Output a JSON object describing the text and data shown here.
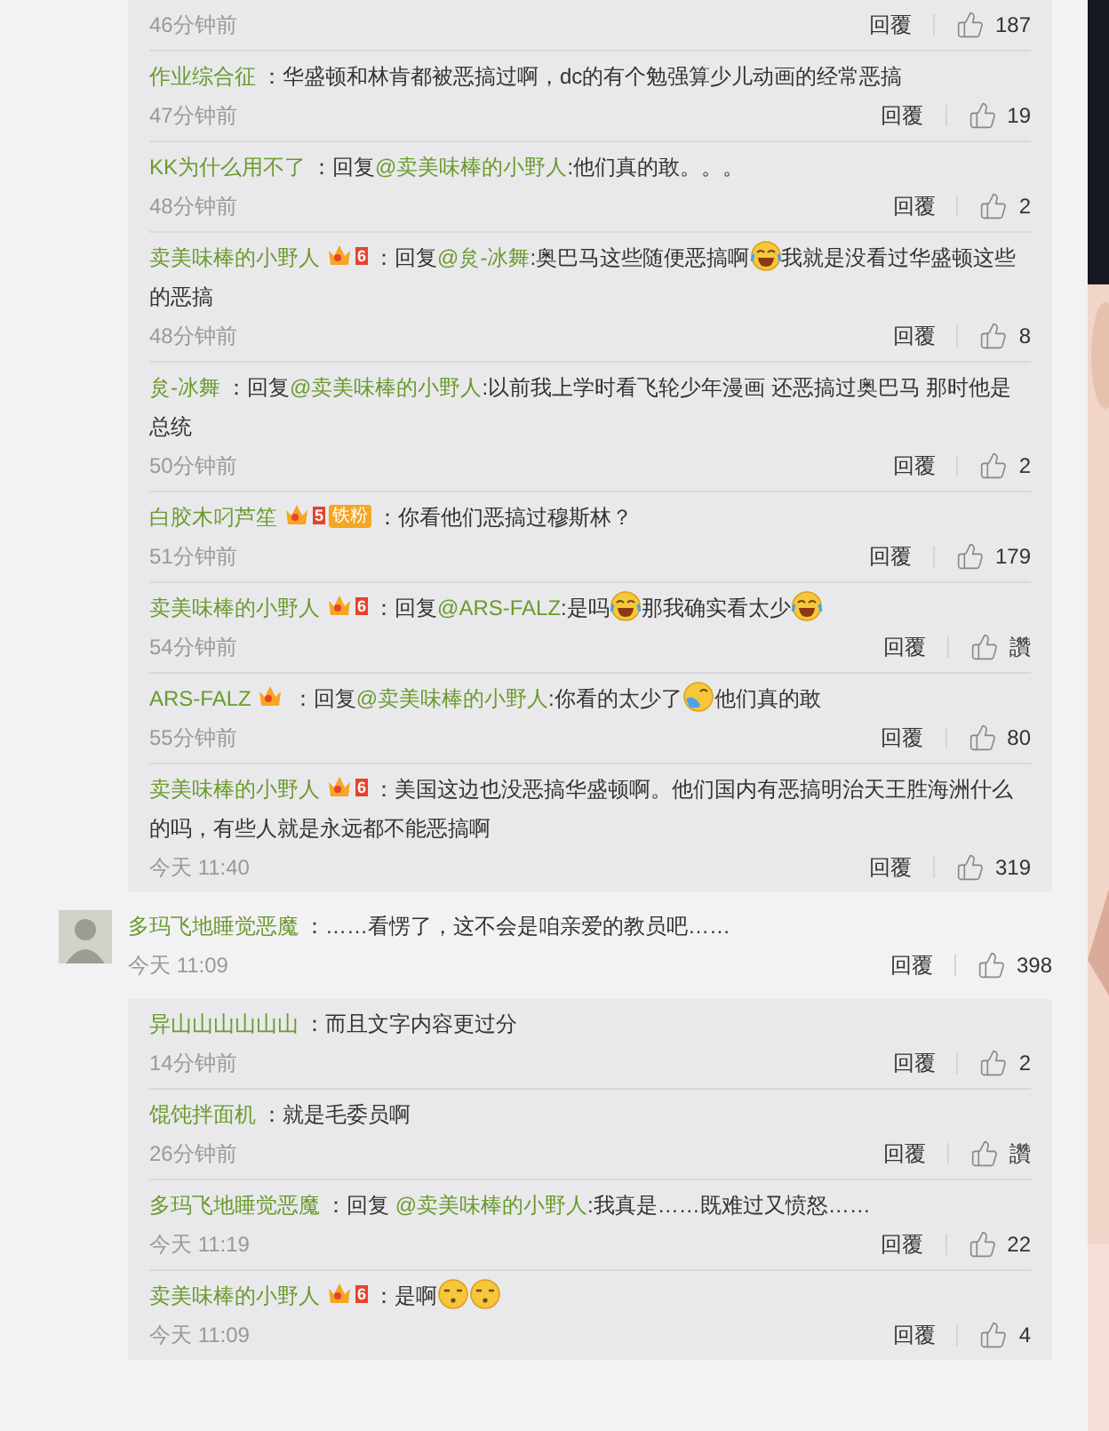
{
  "threads": [
    {
      "kind": "replies",
      "replies": [
        {
          "time": "46分钟前",
          "reply": "回覆",
          "likes": "187"
        },
        {
          "user": "作业综合征",
          "colon": "：",
          "segments": [
            {
              "kind": "text",
              "text": "华盛顿和林肯都被恶搞过啊，dc的有个勉强算少儿动画的经常恶搞"
            }
          ],
          "time": "47分钟前",
          "reply": "回覆",
          "likes": "19"
        },
        {
          "user": "KK为什么用不了",
          "colon": "：",
          "segments": [
            {
              "kind": "text",
              "text": "回复"
            },
            {
              "kind": "mention",
              "text": "@卖美味棒的小野人"
            },
            {
              "kind": "text",
              "text": ":他们真的敢。。。"
            }
          ],
          "time": "48分钟前",
          "reply": "回覆",
          "likes": "2"
        },
        {
          "user": "卖美味棒的小野人",
          "badge": {
            "kind": "level",
            "level": "6"
          },
          "colon": "：",
          "segments": [
            {
              "kind": "text",
              "text": "回复"
            },
            {
              "kind": "mention",
              "text": "@炱-冰舞"
            },
            {
              "kind": "text",
              "text": ":奥巴马这些随便恶搞啊"
            },
            {
              "kind": "laughing"
            },
            {
              "kind": "text",
              "text": "我就是没看过华盛顿这些的恶搞"
            }
          ],
          "time": "48分钟前",
          "reply": "回覆",
          "likes": "8"
        },
        {
          "user": "炱-冰舞",
          "colon": "：",
          "segments": [
            {
              "kind": "text",
              "text": "回复"
            },
            {
              "kind": "mention",
              "text": "@卖美味棒的小野人"
            },
            {
              "kind": "text",
              "text": ":以前我上学时看飞轮少年漫画 还恶搞过奥巴马 那时他是总统"
            }
          ],
          "time": "50分钟前",
          "reply": "回覆",
          "likes": "2"
        },
        {
          "user": "白胶木叼芦笙",
          "badge": {
            "kind": "fan",
            "level": "5",
            "label": "铁粉"
          },
          "colon": "：",
          "segments": [
            {
              "kind": "text",
              "text": "你看他们恶搞过穆斯林？"
            }
          ],
          "time": "51分钟前",
          "reply": "回覆",
          "likes": "179"
        },
        {
          "user": "卖美味棒的小野人",
          "badge": {
            "kind": "level",
            "level": "6"
          },
          "colon": "：",
          "segments": [
            {
              "kind": "text",
              "text": "回复"
            },
            {
              "kind": "mention",
              "text": "@ARS-FALZ"
            },
            {
              "kind": "text",
              "text": ":是吗"
            },
            {
              "kind": "laughing"
            },
            {
              "kind": "text",
              "text": "那我确实看太少"
            },
            {
              "kind": "laughing"
            }
          ],
          "time": "54分钟前",
          "reply": "回覆",
          "likes": "讚"
        },
        {
          "user": "ARS-FALZ",
          "badge": {
            "kind": "plain"
          },
          "colon": "：",
          "segments": [
            {
              "kind": "text",
              "text": "回复"
            },
            {
              "kind": "mention",
              "text": "@卖美味棒的小野人"
            },
            {
              "kind": "text",
              "text": ":你看的太少了"
            },
            {
              "kind": "tearful"
            },
            {
              "kind": "text",
              "text": "他们真的敢"
            }
          ],
          "time": "55分钟前",
          "reply": "回覆",
          "likes": "80"
        },
        {
          "user": "卖美味棒的小野人",
          "badge": {
            "kind": "level",
            "level": "6"
          },
          "colon": "：",
          "segments": [
            {
              "kind": "text",
              "text": "美国这边也没恶搞华盛顿啊。他们国内有恶搞明治天王胜海洲什么的吗，有些人就是永远都不能恶搞啊"
            }
          ],
          "time": "今天 11:40",
          "reply": "回覆",
          "likes": "319"
        }
      ]
    },
    {
      "kind": "comment",
      "user": "多玛飞地睡觉恶魔",
      "colon": "：",
      "segments": [
        {
          "kind": "text",
          "text": "……看愣了，这不会是咱亲爱的教员吧……"
        }
      ],
      "time": "今天 11:09",
      "reply": "回覆",
      "likes": "398"
    },
    {
      "kind": "replies",
      "replies": [
        {
          "user": "异山山山山山山",
          "colon": "：",
          "segments": [
            {
              "kind": "text",
              "text": "而且文字内容更过分"
            }
          ],
          "time": "14分钟前",
          "reply": "回覆",
          "likes": "2"
        },
        {
          "user": "馄饨拌面机",
          "colon": "：",
          "segments": [
            {
              "kind": "text",
              "text": "就是毛委员啊"
            }
          ],
          "time": "26分钟前",
          "reply": "回覆",
          "likes": "讚"
        },
        {
          "user": "多玛飞地睡觉恶魔",
          "colon": "：",
          "segments": [
            {
              "kind": "text",
              "text": "回复 "
            },
            {
              "kind": "mention",
              "text": "@卖美味棒的小野人"
            },
            {
              "kind": "text",
              "text": ":我真是……既难过又愤怒……"
            }
          ],
          "time": "今天 11:19",
          "reply": "回覆",
          "likes": "22"
        },
        {
          "user": "卖美味棒的小野人",
          "badge": {
            "kind": "level",
            "level": "6"
          },
          "colon": "：",
          "segments": [
            {
              "kind": "text",
              "text": "是啊"
            },
            {
              "kind": "sleepy"
            },
            {
              "kind": "sleepy"
            }
          ],
          "time": "今天 11:09",
          "reply": "回覆",
          "likes": "4"
        }
      ]
    }
  ]
}
